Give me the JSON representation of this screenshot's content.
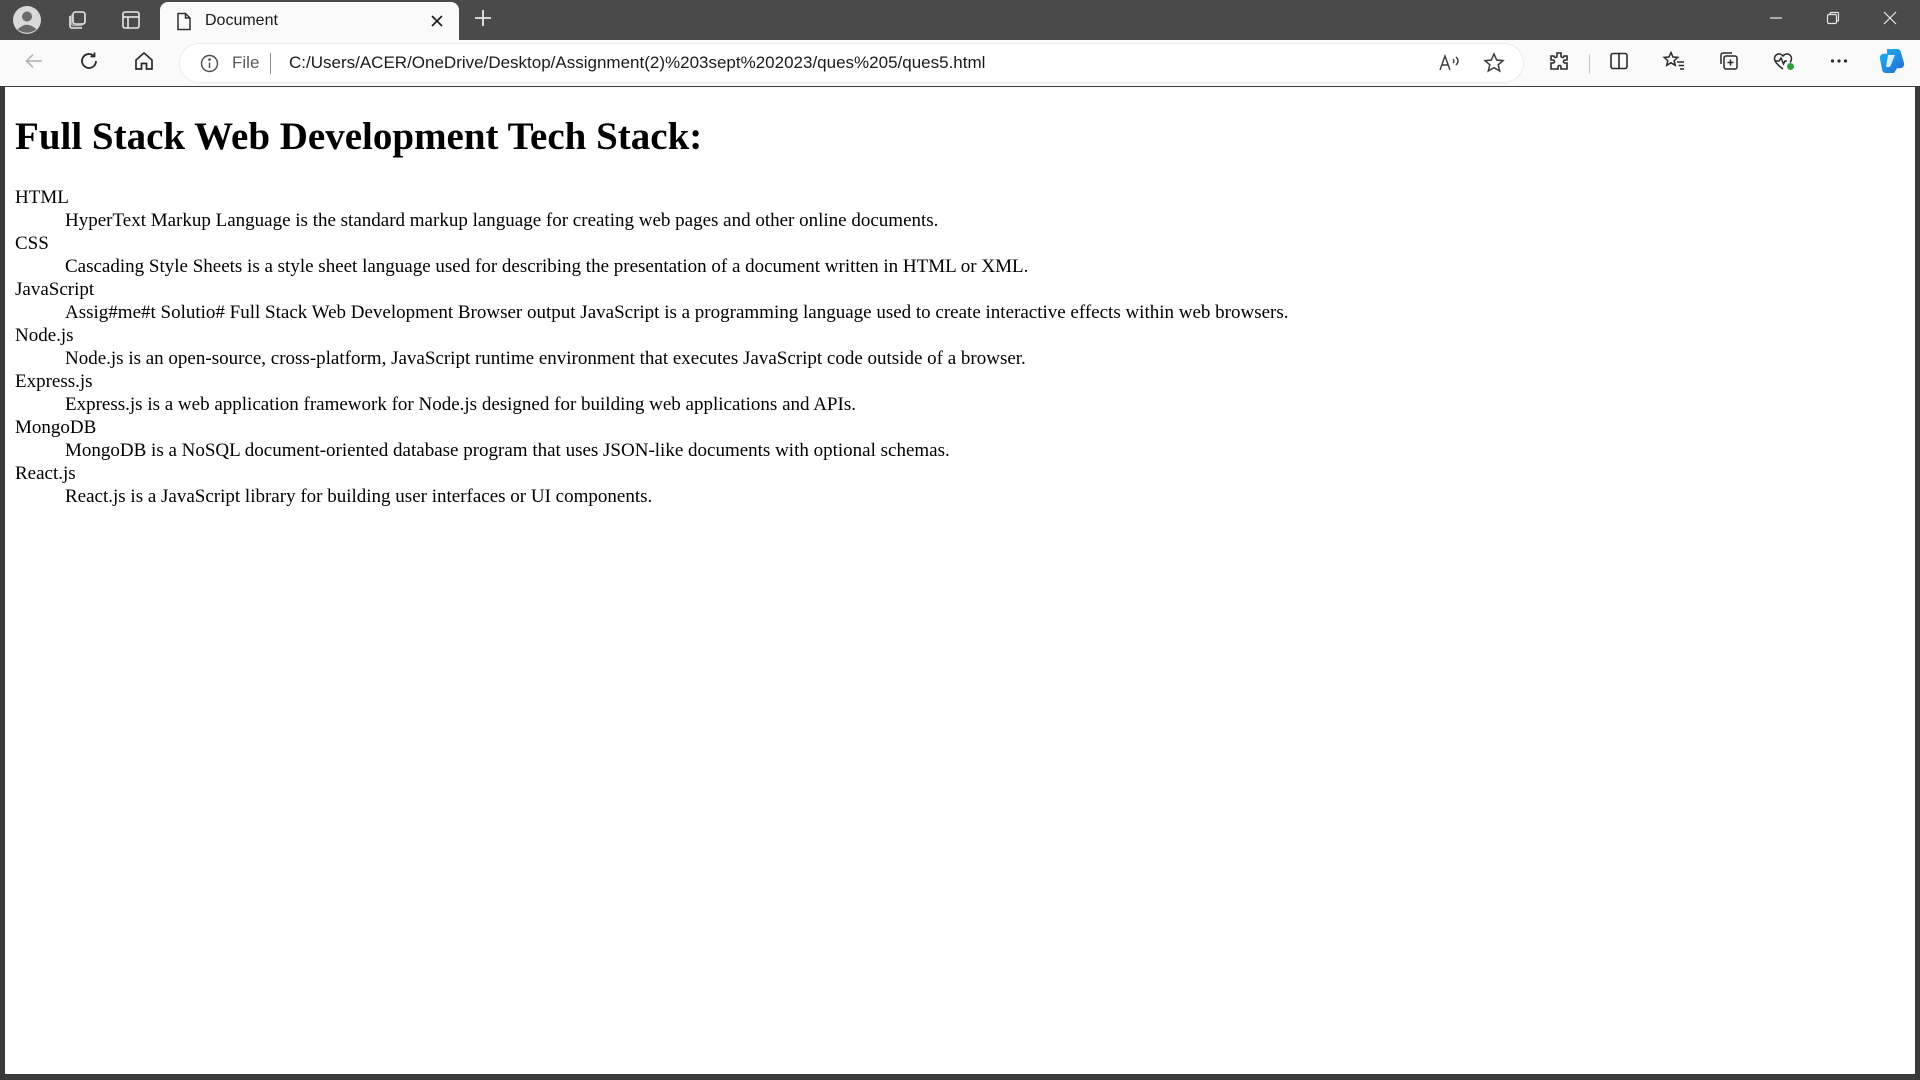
{
  "browser": {
    "tab": {
      "title": "Document"
    },
    "address": {
      "scheme_label": "File",
      "url": "C:/Users/ACER/OneDrive/Desktop/Assignment(2)%203sept%202023/ques%205/ques5.html"
    },
    "icons": {
      "profile": "profile-avatar-icon",
      "workspaces": "workspaces-icon",
      "tab_actions": "tab-actions-icon",
      "page": "page-icon",
      "close_tab": "close-icon",
      "new_tab": "plus-icon",
      "minimize": "minimize-icon",
      "restore": "restore-icon",
      "close_window": "close-icon",
      "back": "back-arrow-icon",
      "refresh": "refresh-icon",
      "home": "home-icon",
      "info": "info-icon",
      "read_aloud": "read-aloud-icon",
      "favorite": "star-icon",
      "extensions": "extensions-icon",
      "split_screen": "split-screen-icon",
      "favorites": "favorites-icon",
      "collections": "collections-icon",
      "browser_essentials": "heart-pulse-icon",
      "more": "more-icon",
      "copilot": "copilot-icon"
    },
    "colors": {
      "frame": "#4a4a4a",
      "toolbar": "#fafafa",
      "copilot_accent": "#1f8de0",
      "essentials_badge": "#2ea043"
    }
  },
  "page": {
    "heading": "Full Stack Web Development Tech Stack:",
    "items": [
      {
        "term": "HTML",
        "description": "HyperText Markup Language is the standard markup language for creating web pages and other online documents."
      },
      {
        "term": "CSS",
        "description": "Cascading Style Sheets is a style sheet language used for describing the presentation of a document written in HTML or XML."
      },
      {
        "term": "JavaScript",
        "description": "Assig#me#t Solutio# Full Stack Web Development Browser output JavaScript is a programming language used to create interactive effects within web browsers."
      },
      {
        "term": "Node.js",
        "description": "Node.js is an open-source, cross-platform, JavaScript runtime environment that executes JavaScript code outside of a browser."
      },
      {
        "term": "Express.js",
        "description": "Express.js is a web application framework for Node.js designed for building web applications and APIs."
      },
      {
        "term": "MongoDB",
        "description": "MongoDB is a NoSQL document-oriented database program that uses JSON-like documents with optional schemas."
      },
      {
        "term": "React.js",
        "description": "React.js is a JavaScript library for building user interfaces or UI components."
      }
    ]
  }
}
